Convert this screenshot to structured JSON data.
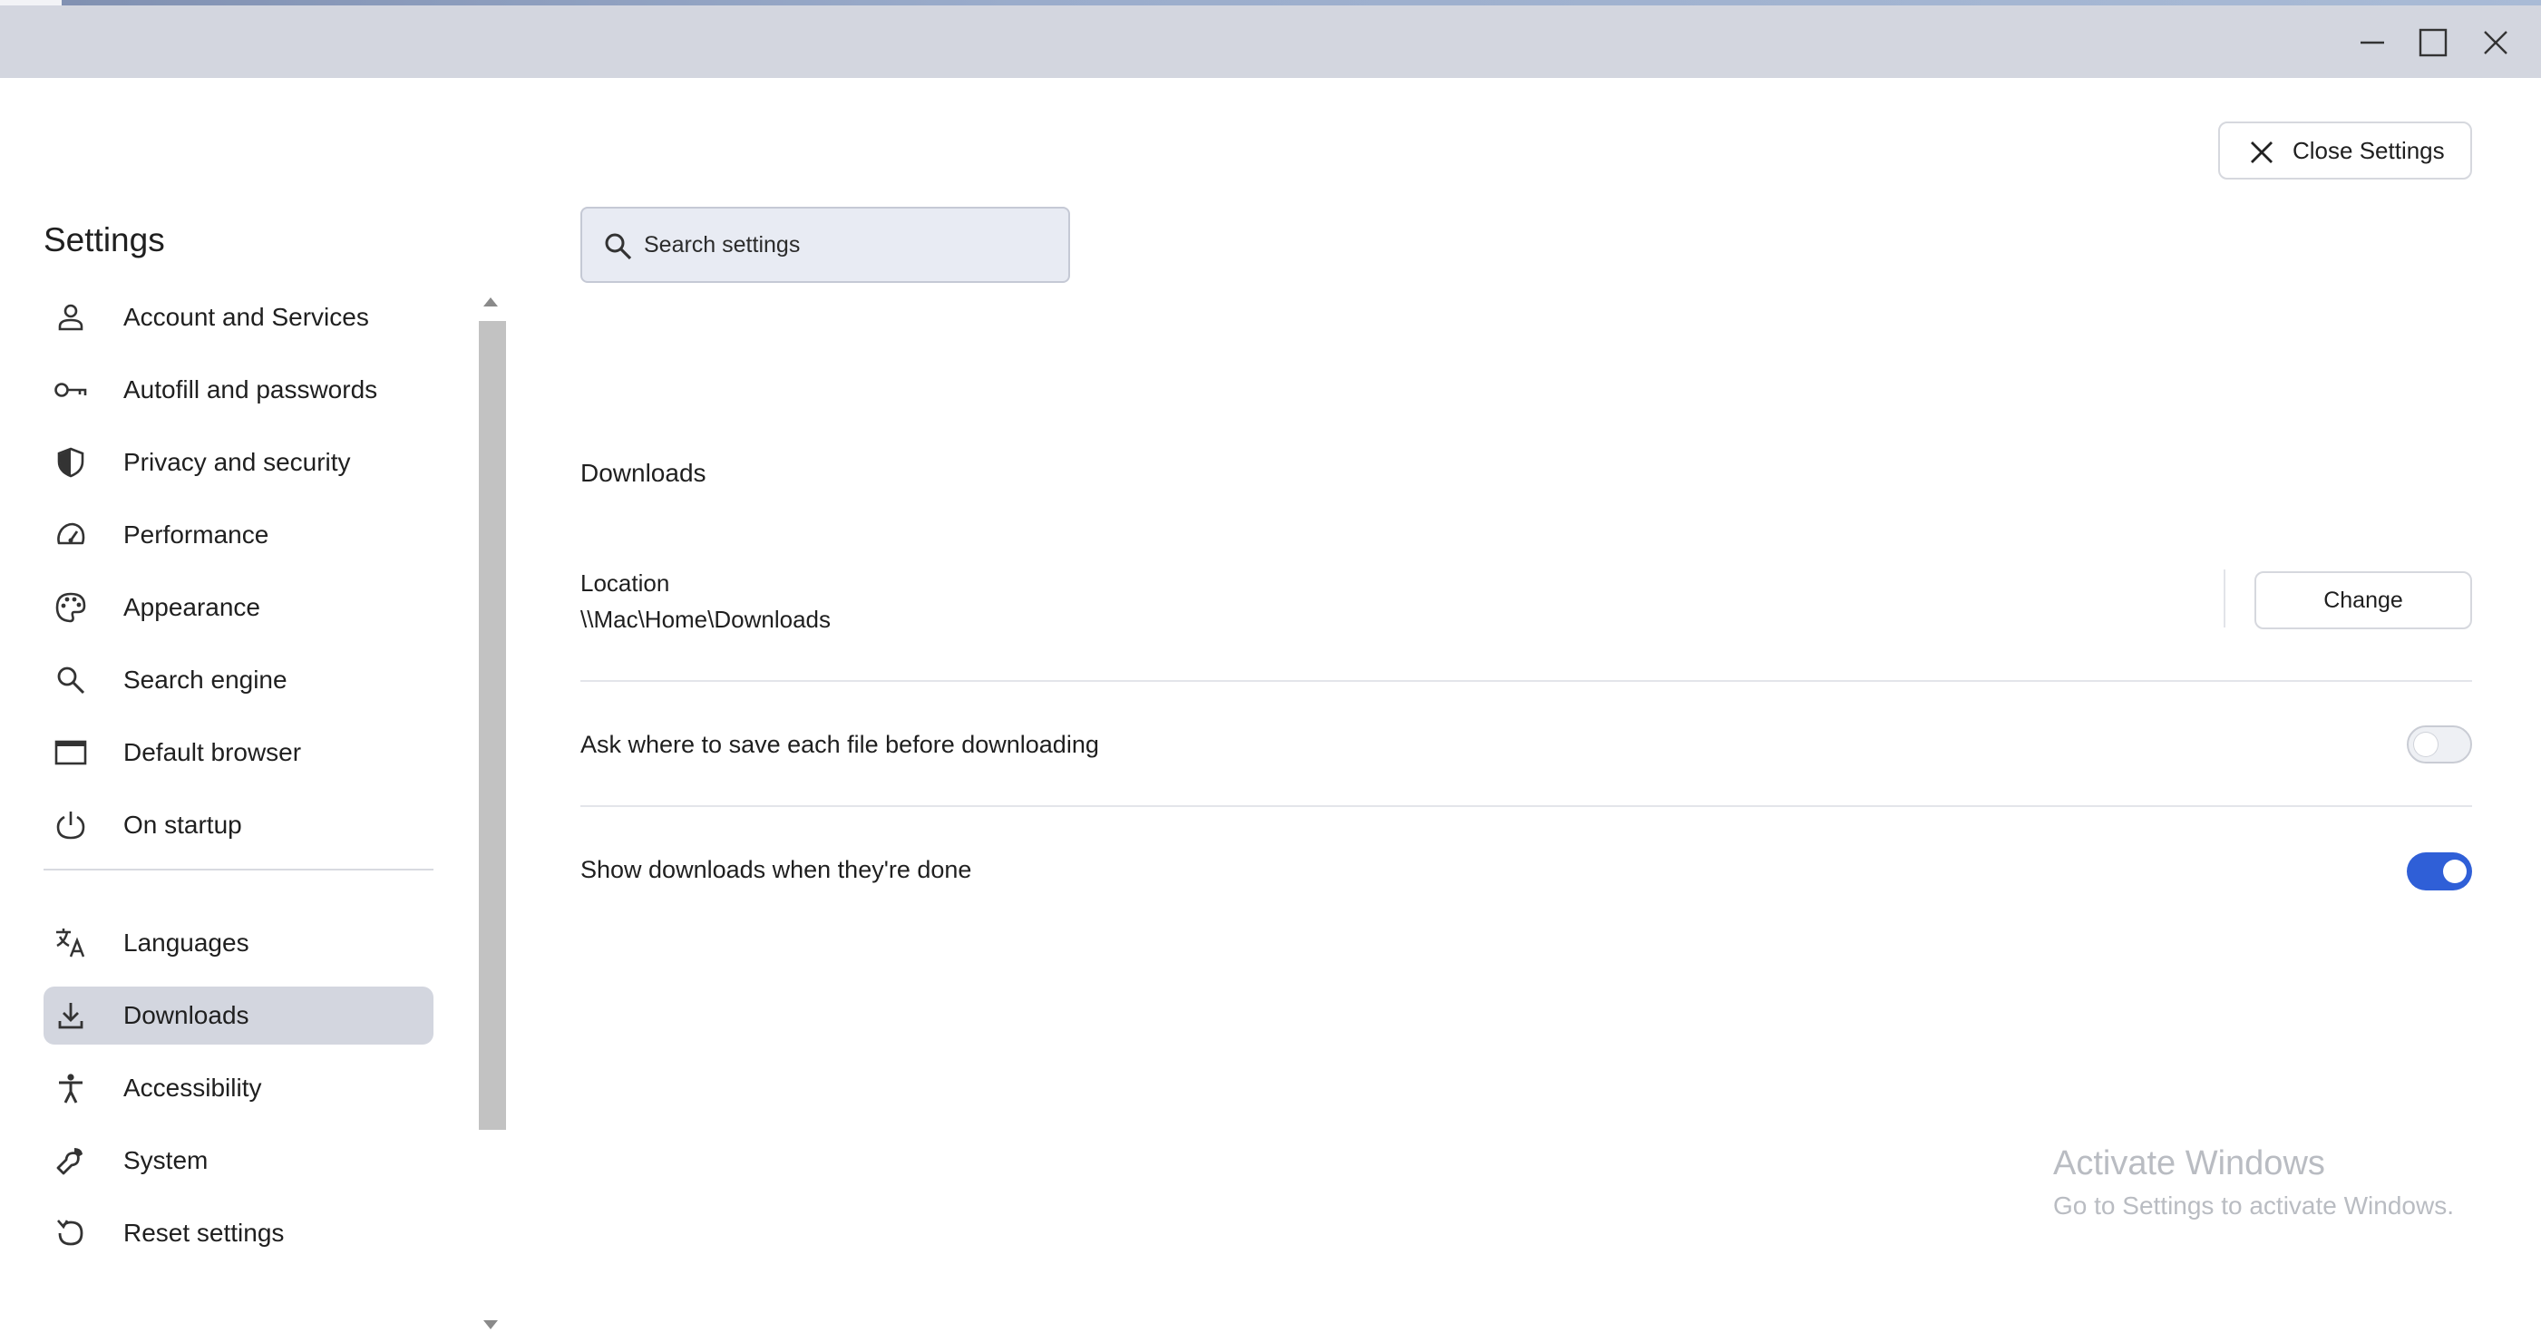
{
  "window": {
    "controls": [
      "minimize",
      "maximize",
      "close"
    ]
  },
  "sidebar": {
    "title": "Settings",
    "items": [
      {
        "label": "Account and Services",
        "icon": "person-icon"
      },
      {
        "label": "Autofill and passwords",
        "icon": "key-icon"
      },
      {
        "label": "Privacy and security",
        "icon": "shield-icon"
      },
      {
        "label": "Performance",
        "icon": "speedometer-icon"
      },
      {
        "label": "Appearance",
        "icon": "palette-icon"
      },
      {
        "label": "Search engine",
        "icon": "search-icon"
      },
      {
        "label": "Default browser",
        "icon": "browser-window-icon"
      },
      {
        "label": "On startup",
        "icon": "power-icon"
      }
    ],
    "items_after_divider": [
      {
        "label": "Languages",
        "icon": "translate-icon"
      },
      {
        "label": "Downloads",
        "icon": "download-icon",
        "active": true
      },
      {
        "label": "Accessibility",
        "icon": "accessibility-icon"
      },
      {
        "label": "System",
        "icon": "wrench-icon"
      },
      {
        "label": "Reset settings",
        "icon": "reset-icon"
      }
    ]
  },
  "header": {
    "close_settings_label": "Close Settings"
  },
  "search": {
    "placeholder": "Search settings"
  },
  "downloads": {
    "section_title": "Downloads",
    "location_label": "Location",
    "location_value": "\\\\Mac\\Home\\Downloads",
    "change_label": "Change",
    "ask_label": "Ask where to save each file before downloading",
    "ask_enabled": false,
    "show_label": "Show downloads when they're done",
    "show_enabled": true
  },
  "watermark": {
    "title": "Activate Windows",
    "subtitle": "Go to Settings to activate Windows."
  },
  "colors": {
    "titlebar": "#d3d6df",
    "active_item": "#d3d6df",
    "toggle_on": "#2f5fd7",
    "search_bg": "#e8ebf3"
  }
}
